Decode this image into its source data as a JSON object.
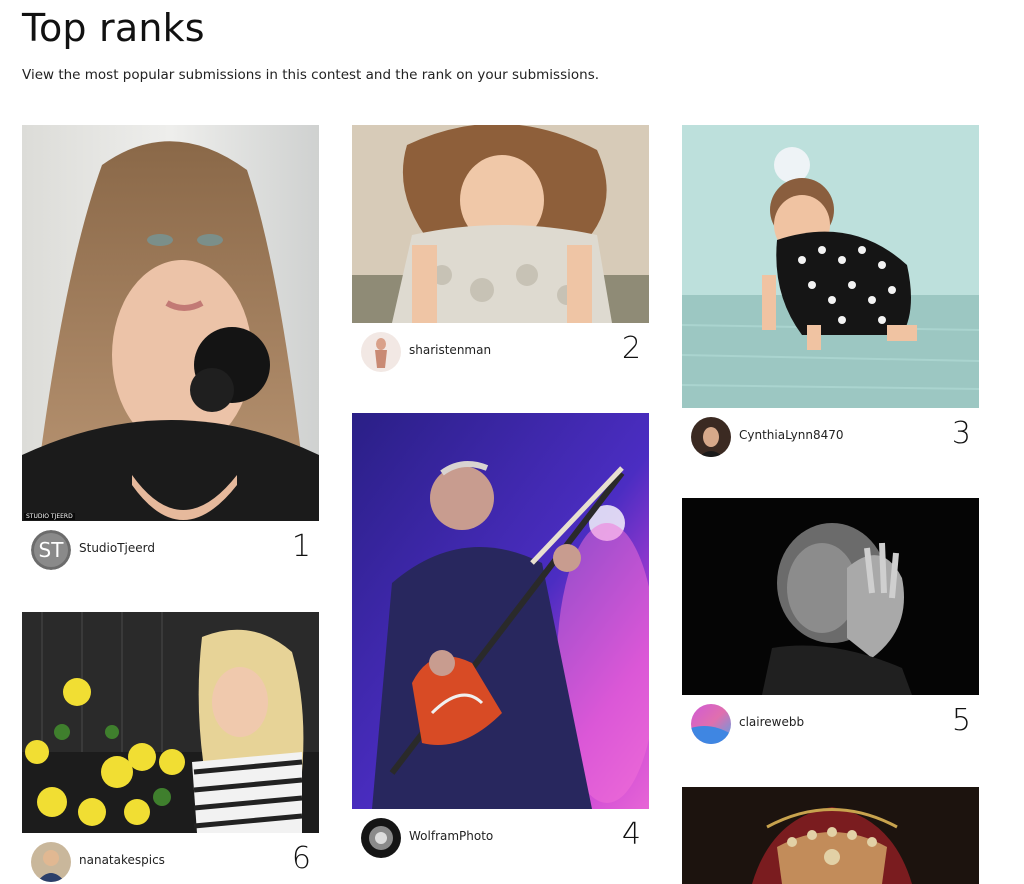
{
  "page": {
    "title": "Top ranks",
    "subtitle": "View the most popular submissions in this contest and the rank on your submissions."
  },
  "submissions": [
    {
      "username": "StudioTjeerd",
      "rank": "1",
      "avatar_text": "ST",
      "watermark": "STUDIO TJEERD"
    },
    {
      "username": "sharistenman",
      "rank": "2"
    },
    {
      "username": "CynthiaLynn8470",
      "rank": "3"
    },
    {
      "username": "WolframPhoto",
      "rank": "4"
    },
    {
      "username": "clairewebb",
      "rank": "5"
    },
    {
      "username": "nanatakespics",
      "rank": "6"
    },
    {
      "username": "",
      "rank": ""
    }
  ],
  "colors": {
    "text": "#111111",
    "background": "#ffffff"
  },
  "icons": {
    "photo_1": "portrait-woman-image",
    "photo_2": "child-curly-hair-image",
    "photo_3": "toddler-in-water-image",
    "photo_4": "guitarist-on-stage-image",
    "photo_5": "man-black-white-image",
    "photo_6": "girl-with-yellow-flowers-image",
    "photo_7": "woman-headdress-image"
  }
}
